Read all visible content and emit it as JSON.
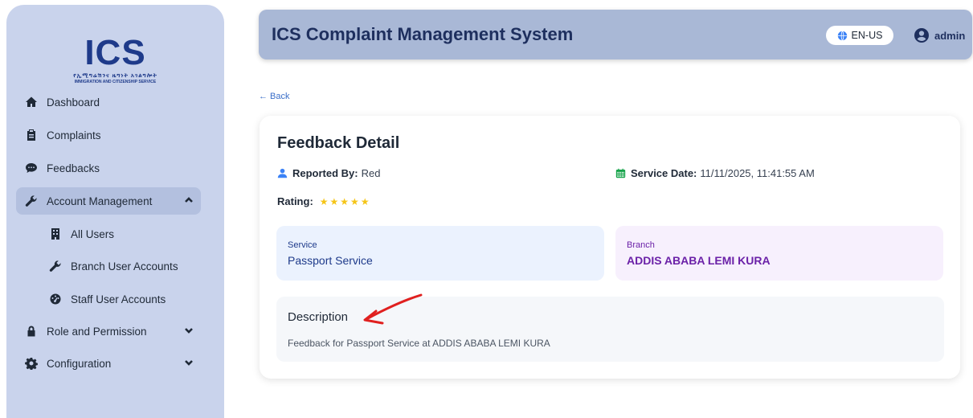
{
  "sidebar": {
    "logo": {
      "text": "ICS",
      "amharic": "የኢሚግሬሽንና ዜግነት አገልግሎት",
      "english": "IMMIGRATION AND CITIZENSHIP SERVICE"
    },
    "items": [
      {
        "label": "Dashboard",
        "icon": "home-icon"
      },
      {
        "label": "Complaints",
        "icon": "clipboard-icon"
      },
      {
        "label": "Feedbacks",
        "icon": "comment-icon"
      },
      {
        "label": "Account Management",
        "icon": "wrench-icon",
        "expanded": true
      },
      {
        "label": "All Users",
        "icon": "building-icon"
      },
      {
        "label": "Branch User Accounts",
        "icon": "wrench-icon"
      },
      {
        "label": "Staff User Accounts",
        "icon": "gauge-icon"
      },
      {
        "label": "Role and Permission",
        "icon": "lock-icon",
        "expanded": false
      },
      {
        "label": "Configuration",
        "icon": "cog-icon",
        "expanded": false
      }
    ]
  },
  "header": {
    "title": "ICS Complaint Management System",
    "language": "EN-US",
    "user": "admin"
  },
  "page": {
    "back_label": "← Back",
    "title": "Feedback Detail",
    "reported_by_label": "Reported By:",
    "reported_by_value": "Red",
    "service_date_label": "Service Date:",
    "service_date_value": "11/11/2025, 11:41:55 AM",
    "rating_label": "Rating:",
    "rating_stars": "★★★★★",
    "rating_value": 5,
    "service_label": "Service",
    "service_value": "Passport Service",
    "branch_label": "Branch",
    "branch_value": "ADDIS ABABA LEMI KURA",
    "description_label": "Description",
    "description_text": "Feedback for Passport Service at ADDIS ABABA LEMI KURA"
  },
  "colors": {
    "sidebar_bg": "#c9d3ec",
    "header_bg": "#a9b8d6",
    "brand_blue": "#1e3a8a",
    "star": "#f5c518",
    "annotation_red": "#e0201f"
  }
}
